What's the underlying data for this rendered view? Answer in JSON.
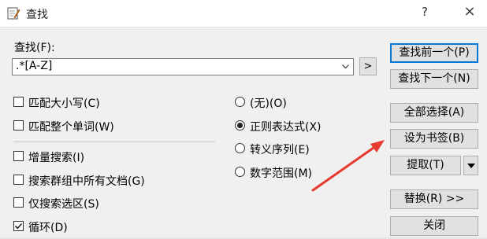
{
  "window": {
    "title": "查找",
    "help_glyph": "?",
    "close_glyph": "×"
  },
  "find": {
    "label": "查找(F):",
    "value": ".*[A-Z]",
    "expand_button": ">"
  },
  "options": [
    {
      "label": "匹配大小写(C)",
      "checked": false
    },
    {
      "label": "匹配整个单词(W)",
      "checked": false
    },
    {
      "label": "增量搜索(I)",
      "checked": false
    },
    {
      "label": "搜索群组中所有文档(G)",
      "checked": false
    },
    {
      "label": "仅搜索选区(S)",
      "checked": false
    },
    {
      "label": "循环(D)",
      "checked": true
    }
  ],
  "modes": [
    {
      "label": "(无)(O)",
      "selected": false
    },
    {
      "label": "正则表达式(X)",
      "selected": true
    },
    {
      "label": "转义序列(E)",
      "selected": false
    },
    {
      "label": "数字范围(M)",
      "selected": false
    }
  ],
  "buttons": {
    "find_prev": "查找前一个(P)",
    "find_next": "查找下一个(N)",
    "select_all": "全部选择(A)",
    "bookmark": "设为书签(B)",
    "extract": "提取(T)",
    "replace": "替换(R) >>",
    "close": "关闭"
  },
  "colors": {
    "annotation_arrow": "#e53a2e",
    "default_button_border": "#0078d7"
  }
}
